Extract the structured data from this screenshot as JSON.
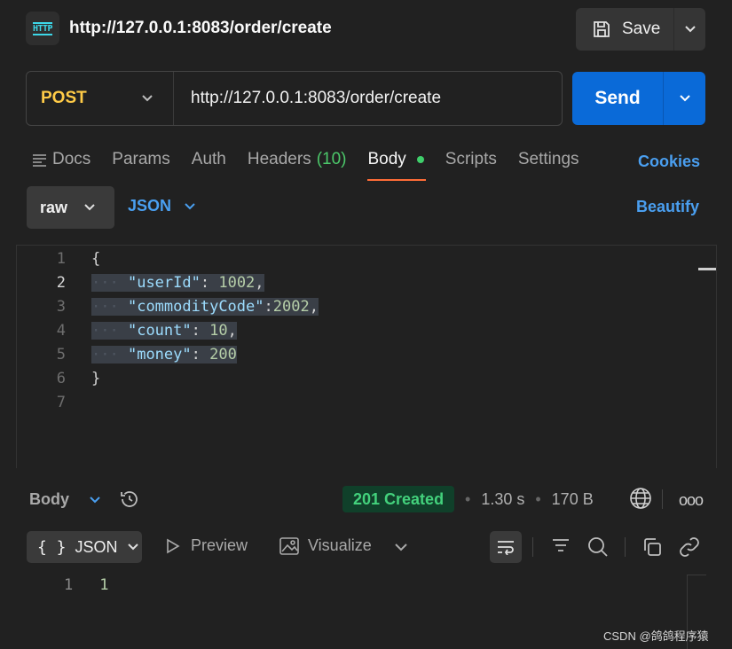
{
  "request": {
    "title": "http://127.0.0.1:8083/order/create",
    "save_label": "Save",
    "method": "POST",
    "url": "http://127.0.0.1:8083/order/create",
    "send_label": "Send"
  },
  "tabs": {
    "docs": "Docs",
    "params": "Params",
    "auth": "Auth",
    "headers": "Headers",
    "headers_count": "(10)",
    "body": "Body",
    "scripts": "Scripts",
    "settings": "Settings",
    "cookies": "Cookies"
  },
  "body_mode": {
    "raw": "raw",
    "format": "JSON",
    "beautify": "Beautify"
  },
  "editor": {
    "line_numbers": [
      "1",
      "2",
      "3",
      "4",
      "5",
      "6",
      "7"
    ],
    "open_brace": "{",
    "close_brace": "}",
    "fields": [
      {
        "key": "\"userId\"",
        "sep": ": ",
        "value": "1002",
        "trail": ","
      },
      {
        "key": "\"commodityCode\"",
        "sep": ":",
        "value": "2002",
        "trail": ","
      },
      {
        "key": "\"count\"",
        "sep": ": ",
        "value": "10",
        "trail": ","
      },
      {
        "key": "\"money\"",
        "sep": ": ",
        "value": "200",
        "trail": ""
      }
    ]
  },
  "response": {
    "body_label": "Body",
    "status": "201 Created",
    "time": "1.30 s",
    "size": "170 B",
    "format": "JSON",
    "preview": "Preview",
    "visualize": "Visualize",
    "line_number": "1",
    "value": "1"
  },
  "colors": {
    "method": "#ffcb47",
    "send": "#0a6ad8",
    "link": "#4a9ff0",
    "status_bg": "#10402a",
    "status_text": "#43d17c",
    "active_tab_underline": "#ff6c37"
  },
  "watermark": "CSDN @鸽鸽程序猿"
}
